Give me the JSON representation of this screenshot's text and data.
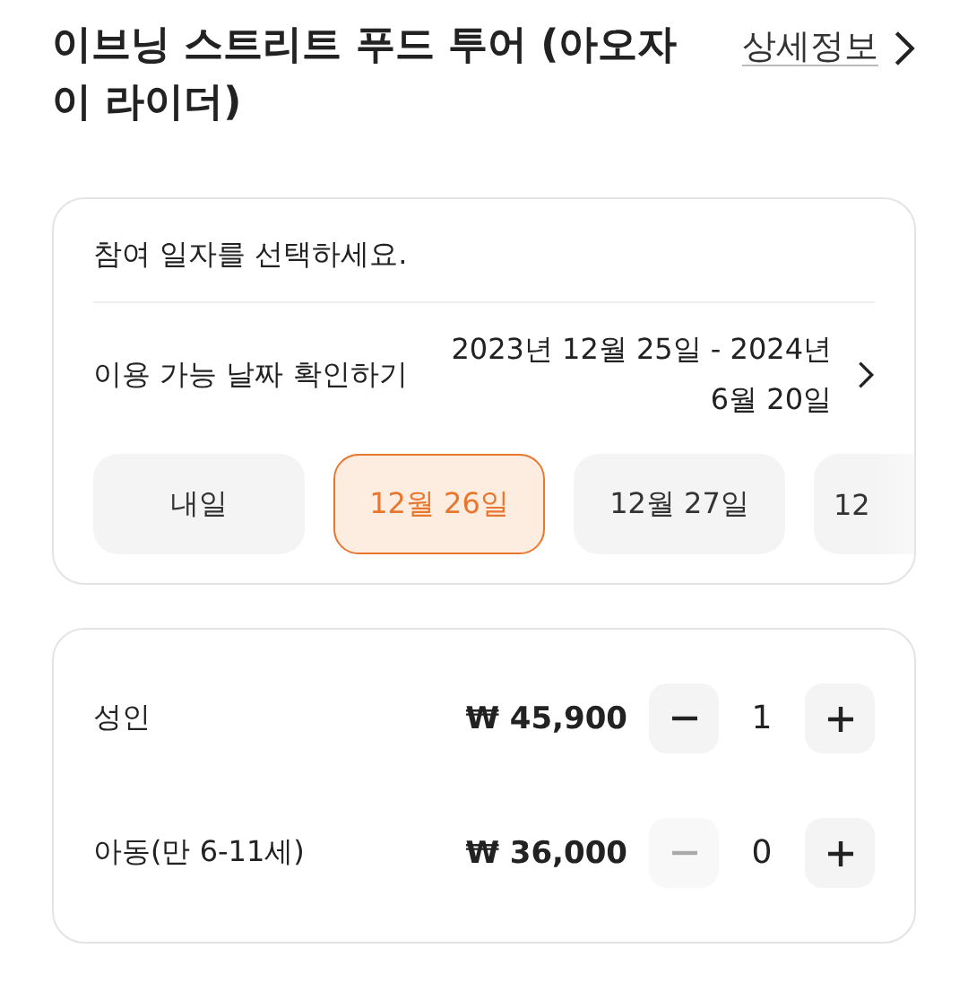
{
  "title": "이브닝 스트리트 푸드 투어 (아오자이 라이더)",
  "details_link": {
    "label": "상세정보"
  },
  "date_card": {
    "prompt": "참여 일자를 선택하세요.",
    "availability": {
      "label": "이용 가능 날짜 확인하기",
      "range": "2023년 12월 25일 - 2024년 6월 20일"
    },
    "dates": [
      {
        "label": "내일",
        "selected": false
      },
      {
        "label": "12월 26일",
        "selected": true
      },
      {
        "label": "12월 27일",
        "selected": false
      },
      {
        "label": "12",
        "selected": false
      }
    ]
  },
  "tickets": [
    {
      "name": "성인",
      "price": "₩ 45,900",
      "count": "1",
      "minus_disabled": false,
      "plus_disabled": false
    },
    {
      "name": "아동(만 6-11세)",
      "price": "₩ 36,000",
      "count": "0",
      "minus_disabled": true,
      "plus_disabled": false
    }
  ]
}
